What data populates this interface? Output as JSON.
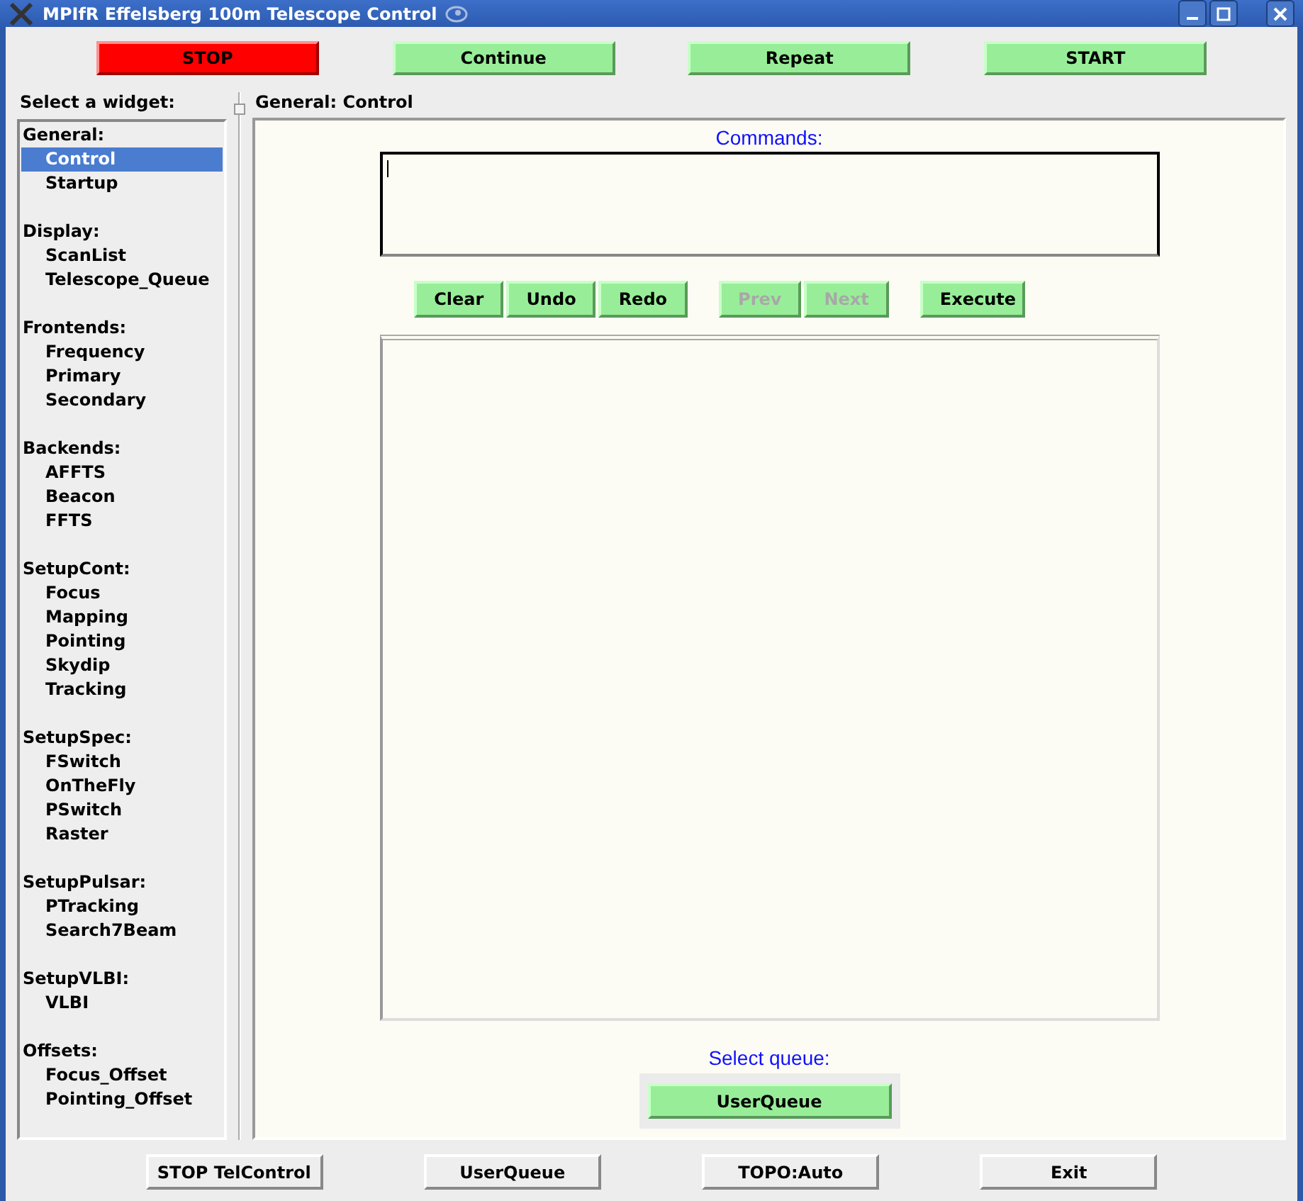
{
  "window": {
    "title": "MPIfR Effelsberg 100m Telescope Control"
  },
  "top_buttons": [
    {
      "label": "STOP",
      "kind": "danger"
    },
    {
      "label": "Continue",
      "kind": "go"
    },
    {
      "label": "Repeat",
      "kind": "go"
    },
    {
      "label": "START",
      "kind": "go"
    }
  ],
  "sidebar": {
    "title": "Select a widget:",
    "groups": [
      {
        "label": "General:",
        "children": [
          {
            "label": "Control",
            "selected": true
          },
          {
            "label": "Startup",
            "selected": false
          }
        ]
      },
      {
        "label": "Display:",
        "children": [
          {
            "label": "ScanList",
            "selected": false
          },
          {
            "label": "Telescope_Queue",
            "selected": false
          }
        ]
      },
      {
        "label": "Frontends:",
        "children": [
          {
            "label": "Frequency",
            "selected": false
          },
          {
            "label": "Primary",
            "selected": false
          },
          {
            "label": "Secondary",
            "selected": false
          }
        ]
      },
      {
        "label": "Backends:",
        "children": [
          {
            "label": "AFFTS",
            "selected": false
          },
          {
            "label": "Beacon",
            "selected": false
          },
          {
            "label": "FFTS",
            "selected": false
          }
        ]
      },
      {
        "label": "SetupCont:",
        "children": [
          {
            "label": "Focus",
            "selected": false
          },
          {
            "label": "Mapping",
            "selected": false
          },
          {
            "label": "Pointing",
            "selected": false
          },
          {
            "label": "Skydip",
            "selected": false
          },
          {
            "label": "Tracking",
            "selected": false
          }
        ]
      },
      {
        "label": "SetupSpec:",
        "children": [
          {
            "label": "FSwitch",
            "selected": false
          },
          {
            "label": "OnTheFly",
            "selected": false
          },
          {
            "label": "PSwitch",
            "selected": false
          },
          {
            "label": "Raster",
            "selected": false
          }
        ]
      },
      {
        "label": "SetupPulsar:",
        "children": [
          {
            "label": "PTracking",
            "selected": false
          },
          {
            "label": "Search7Beam",
            "selected": false
          }
        ]
      },
      {
        "label": "SetupVLBI:",
        "children": [
          {
            "label": "VLBI",
            "selected": false
          }
        ]
      },
      {
        "label": "Offsets:",
        "children": [
          {
            "label": "Focus_Offset",
            "selected": false
          },
          {
            "label": "Pointing_Offset",
            "selected": false
          }
        ]
      }
    ]
  },
  "panel": {
    "title": "General: Control",
    "commands_label": "Commands:",
    "command_buttons": [
      [
        {
          "label": "Clear",
          "disabled": false
        },
        {
          "label": "Undo",
          "disabled": false
        },
        {
          "label": "Redo",
          "disabled": false
        }
      ],
      [
        {
          "label": "Prev",
          "disabled": true
        },
        {
          "label": "Next",
          "disabled": true
        }
      ],
      [
        {
          "label": "Execute",
          "disabled": false
        }
      ]
    ],
    "queue_label": "Select queue:",
    "queue_button": "UserQueue"
  },
  "bottom_buttons": [
    "STOP TelControl",
    "UserQueue",
    "TOPO:Auto",
    "Exit"
  ]
}
